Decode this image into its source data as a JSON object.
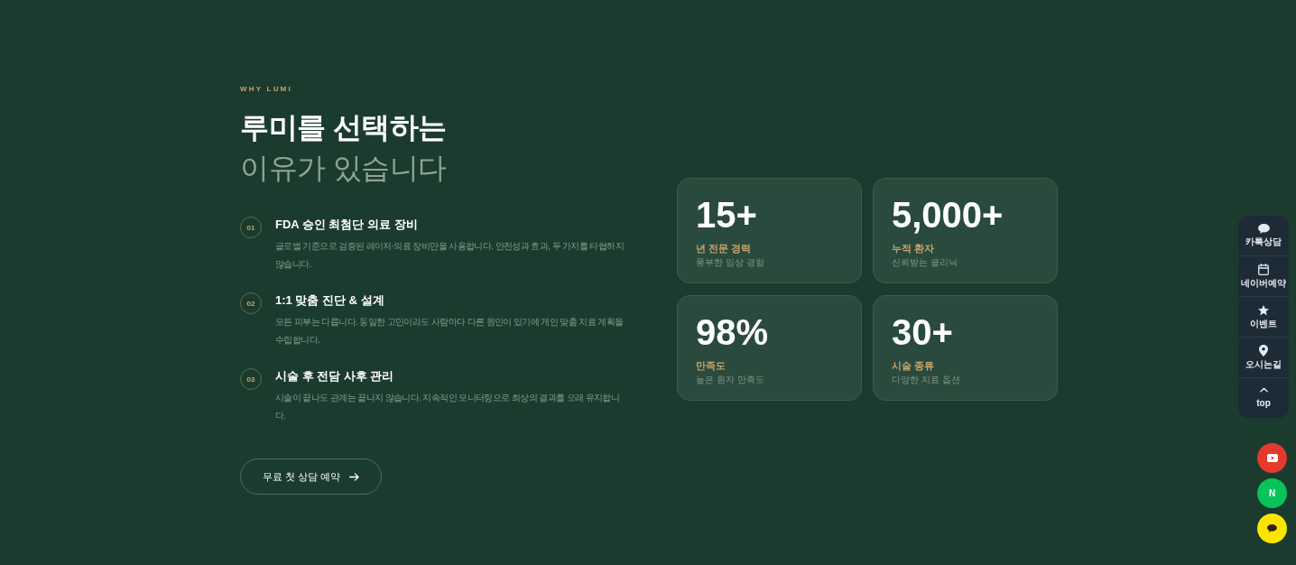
{
  "section": {
    "eyebrow": "WHY LUMI",
    "title_line_1": "루미를 선택하는",
    "title_line_2": "이유가 있습니다"
  },
  "features": [
    {
      "number": "01",
      "title": "FDA 승인 최첨단 의료 장비",
      "description": "글로벌 기준으로 검증된 레이저·의료 장비만을 사용합니다. 안전성과 효과, 두 가지를 타협하지 않습니다."
    },
    {
      "number": "02",
      "title": "1:1 맞춤 진단 & 설계",
      "description": "모든 피부는 다릅니다. 동일한 고민이라도 사람마다 다른 원인이 있기에 개인 맞춤 치료 계획을 수립합니다."
    },
    {
      "number": "03",
      "title": "시술 후 전담 사후 관리",
      "description": "시술이 끝나도 관계는 끝나지 않습니다. 지속적인 모니터링으로 최상의 결과를 오래 유지합니다."
    }
  ],
  "cta_button": {
    "label": "무료 첫 상담 예약"
  },
  "stats": [
    {
      "value": "15+",
      "label": "년 전문 경력",
      "caption": "풍부한 임상 경험"
    },
    {
      "value": "5,000+",
      "label": "누적 환자",
      "caption": "신뢰받는 클리닉"
    },
    {
      "value": "98%",
      "label": "만족도",
      "caption": "높은 환자 만족도"
    },
    {
      "value": "30+",
      "label": "시술 종류",
      "caption": "다양한 치료 옵션"
    }
  ],
  "quick_menu": [
    {
      "kind": "chat",
      "label": "카톡상담"
    },
    {
      "kind": "calendar",
      "label": "네이버예약"
    },
    {
      "kind": "star",
      "label": "이벤트"
    },
    {
      "kind": "pin",
      "label": "오시는길"
    },
    {
      "kind": "top",
      "label": "top"
    }
  ],
  "social_buttons": [
    {
      "kind": "youtube",
      "color": "#e5392d"
    },
    {
      "kind": "naver",
      "label": "N",
      "color": "#07c359"
    },
    {
      "kind": "kakao",
      "color": "#fee500"
    }
  ]
}
